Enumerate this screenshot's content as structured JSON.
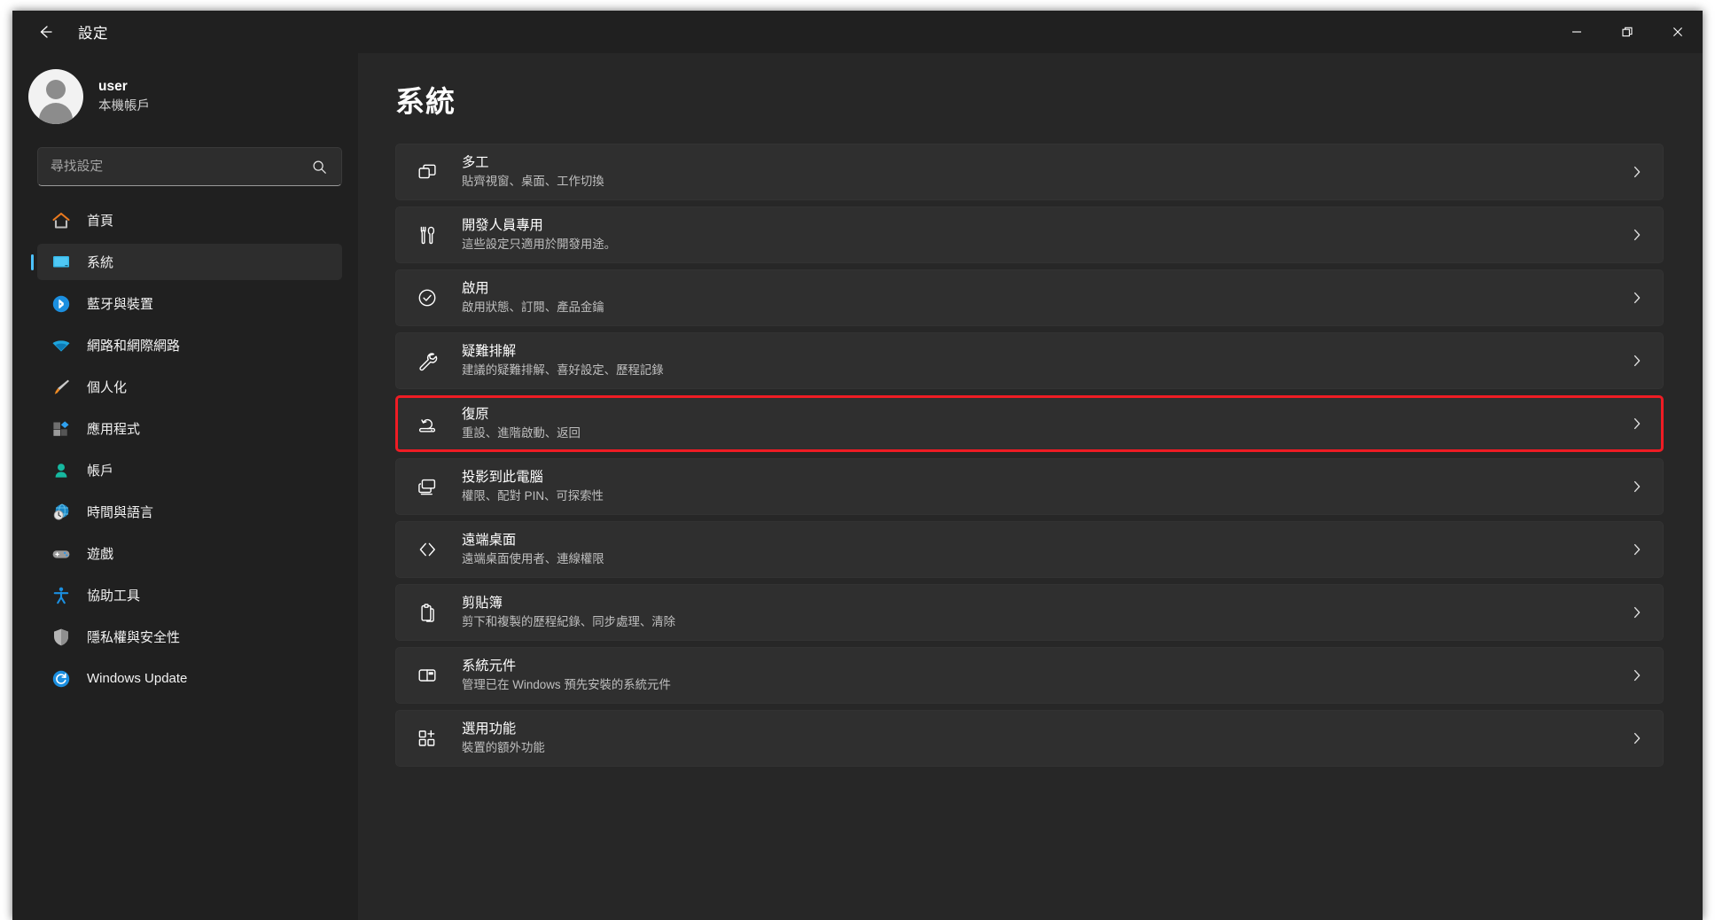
{
  "window": {
    "title": "設定",
    "back_icon": "back-arrow-icon",
    "controls": {
      "minimize": "minimize-icon",
      "restore": "restore-icon",
      "close": "close-icon"
    }
  },
  "sidebar": {
    "account": {
      "name": "user",
      "type": "本機帳戶",
      "avatar": "user-avatar"
    },
    "search": {
      "placeholder": "尋找設定",
      "value": "",
      "icon": "search-icon"
    },
    "items": [
      {
        "label": "首頁",
        "icon": "home-icon",
        "selected": false
      },
      {
        "label": "系統",
        "icon": "system-monitor-icon",
        "selected": true
      },
      {
        "label": "藍牙與裝置",
        "icon": "bluetooth-icon",
        "selected": false
      },
      {
        "label": "網路和網際網路",
        "icon": "wifi-icon",
        "selected": false
      },
      {
        "label": "個人化",
        "icon": "paintbrush-icon",
        "selected": false
      },
      {
        "label": "應用程式",
        "icon": "apps-icon",
        "selected": false
      },
      {
        "label": "帳戶",
        "icon": "account-person-icon",
        "selected": false
      },
      {
        "label": "時間與語言",
        "icon": "clock-globe-icon",
        "selected": false
      },
      {
        "label": "遊戲",
        "icon": "gamepad-icon",
        "selected": false
      },
      {
        "label": "協助工具",
        "icon": "accessibility-icon",
        "selected": false
      },
      {
        "label": "隱私權與安全性",
        "icon": "shield-icon",
        "selected": false
      },
      {
        "label": "Windows Update",
        "icon": "update-refresh-icon",
        "selected": false
      }
    ]
  },
  "main": {
    "title": "系統",
    "chevron_icon": "chevron-right-icon",
    "highlight_color": "#ef1c24",
    "rows": [
      {
        "title": "多工",
        "subtitle": "貼齊視窗、桌面、工作切換",
        "icon": "multitasking-windows-icon",
        "highlighted": false
      },
      {
        "title": "開發人員專用",
        "subtitle": "這些設定只適用於開發用途。",
        "icon": "developer-tools-icon",
        "highlighted": false
      },
      {
        "title": "啟用",
        "subtitle": "啟用狀態、訂閱、產品金鑰",
        "icon": "activation-check-icon",
        "highlighted": false
      },
      {
        "title": "疑難排解",
        "subtitle": "建議的疑難排解、喜好設定、歷程記錄",
        "icon": "wrench-icon",
        "highlighted": false
      },
      {
        "title": "復原",
        "subtitle": "重設、進階啟動、返回",
        "icon": "recovery-icon",
        "highlighted": true
      },
      {
        "title": "投影到此電腦",
        "subtitle": "權限、配對 PIN、可探索性",
        "icon": "project-to-pc-icon",
        "highlighted": false
      },
      {
        "title": "遠端桌面",
        "subtitle": "遠端桌面使用者、連線權限",
        "icon": "remote-desktop-icon",
        "highlighted": false
      },
      {
        "title": "剪貼簿",
        "subtitle": "剪下和複製的歷程紀錄、同步處理、清除",
        "icon": "clipboard-icon",
        "highlighted": false
      },
      {
        "title": "系統元件",
        "subtitle": "管理已在 Windows 預先安裝的系統元件",
        "icon": "system-components-icon",
        "highlighted": false
      },
      {
        "title": "選用功能",
        "subtitle": "裝置的額外功能",
        "icon": "optional-features-icon",
        "highlighted": false
      }
    ]
  }
}
